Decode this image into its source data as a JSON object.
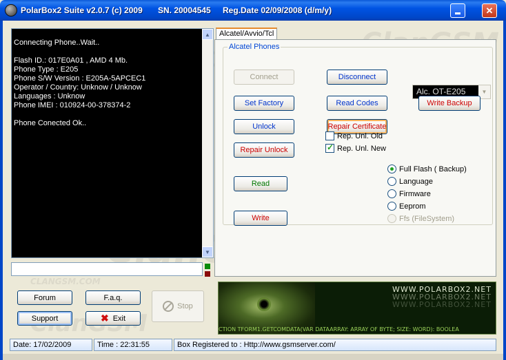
{
  "window": {
    "title": "PolarBox2 Suite  v2.0.7 (c) 2009",
    "serial": "SN. 20004545",
    "reg_date": "Reg.Date 02/09/2008 (d/m/y)"
  },
  "watermark": {
    "brand": "ClanGSM",
    "small": "CLANGSM",
    "domain": "CLANGSM.COM"
  },
  "log": {
    "lines": [
      "Connecting Phone..Wait..",
      "",
      "Flash ID.: 017E0A01 ,  AMD 4 Mb.",
      "Phone Type : E205",
      "Phone S/W Version : E205A-5APCEC1",
      "Operator / Country: Unknow / Unknow",
      "Languages : Unknow",
      "Phone IMEI : 010924-00-378374-2",
      "",
      "Phone Conected Ok.."
    ]
  },
  "buttons": {
    "forum": "Forum",
    "faq": "F.a.q.",
    "support": "Support",
    "exit": "Exit",
    "stop": "Stop"
  },
  "tab": {
    "label": "Alcatel/Avvio/Tcl",
    "group_label": "Alcatel Phones",
    "connect": "Connect",
    "disconnect": "Disconnect",
    "model_select": "Alc. OT-E205",
    "set_factory": "Set Factory",
    "read_codes": "Read Codes",
    "write_backup": "Write Backup",
    "unlock": "Unlock",
    "repair_certificate": "Repair Certificate",
    "repair_unlock": "Repair Unlock",
    "rep_unl_old": "Rep. Unl. Old",
    "rep_unl_new": "Rep. Unl. New",
    "read": "Read",
    "write": "Write",
    "options": {
      "full_flash": "Full Flash ( Backup)",
      "language": "Language",
      "firmware": "Firmware",
      "eeprom": "Eeprom",
      "ffs": "Ffs (FileSystem)"
    },
    "checks": {
      "rep_unl_old": false,
      "rep_unl_new": true
    },
    "selected_option": "full_flash"
  },
  "banner": {
    "url": "WWW.POLARBOX2.NET",
    "ticker": "CTION TFORM1.GETCOMDATA(VAR DATAARRAY: ARRAY OF BYTE; SIZE: WORD): BOOLEA"
  },
  "status": {
    "date": "Date: 17/02/2009",
    "time": "Time :  22:31:55",
    "box": "Box  Registered to : Http://www.gsmserver.com/"
  },
  "colors": {
    "accent_blue": "#0046d5",
    "danger_red": "#cc0000",
    "ok_green": "#007700"
  }
}
